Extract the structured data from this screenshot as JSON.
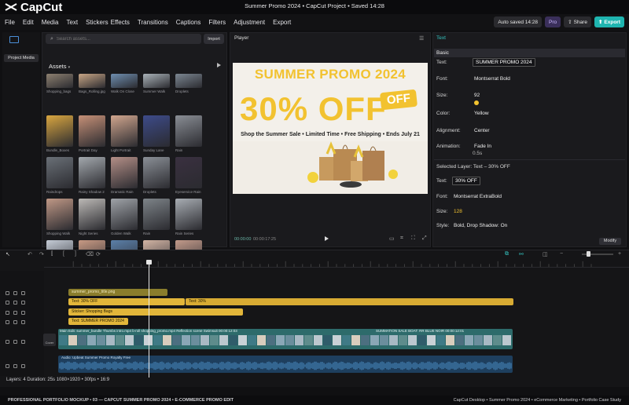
{
  "window": {
    "app_name": "CapCut",
    "title": "Summer Promo 2024 • CapCut Project • Saved 14:28"
  },
  "menu": [
    "File",
    "Edit",
    "Media",
    "Text",
    "Stickers",
    "Effects",
    "Transitions",
    "Captions",
    "Filters",
    "Adjustment",
    "Export"
  ],
  "header_actions": {
    "autosave": "Auto saved 14:28",
    "pro": "Pro",
    "share": "Share",
    "export": "Export"
  },
  "left_rail": {
    "project_media": "Project Media"
  },
  "media": {
    "search_placeholder": "Search assets...",
    "import_label": "Import",
    "assets_label": "Assets",
    "thumbnails": [
      {
        "label": "Shopping_bags",
        "color": "#8d8070"
      },
      {
        "label": "Bags_Rolling.jpg",
        "color": "#c7a585"
      },
      {
        "label": "Walk On Close",
        "color": "#6f8fb0"
      },
      {
        "label": "Summer Walk",
        "color": "#a9b2b8"
      },
      {
        "label": "Droplets",
        "color": "#7c8792"
      },
      {
        "label": "Bundle_Boxes",
        "color": "#d9a640"
      },
      {
        "label": "Portrait Day",
        "color": "#c69077"
      },
      {
        "label": "Light Portrait",
        "color": "#d1a68e"
      },
      {
        "label": "Sunday Lane",
        "color": "#3d4b8a"
      },
      {
        "label": "Rain",
        "color": "#8a8e95"
      },
      {
        "label": "Raindrops",
        "color": "#6a7077"
      },
      {
        "label": "Rainy Shadow 2",
        "color": "#a3a8ad"
      },
      {
        "label": "Dramatic Rain",
        "color": "#b48f87"
      },
      {
        "label": "Droplets",
        "color": "#8b9097"
      },
      {
        "label": "Eyeservice Rain",
        "color": "#3a3040"
      },
      {
        "label": "Shopping Walk",
        "color": "#c09886"
      },
      {
        "label": "Night Series",
        "color": "#bcb9b6"
      },
      {
        "label": "Golden Walk",
        "color": "#9fa3a8"
      },
      {
        "label": "Rain",
        "color": "#7e8489"
      },
      {
        "label": "Rain Series",
        "color": "#a8adb3"
      },
      {
        "label": "",
        "color": "#c5ccd6"
      },
      {
        "label": "",
        "color": "#c89a84"
      },
      {
        "label": "",
        "color": "#5b7fa8"
      },
      {
        "label": "",
        "color": "#d2b4a4"
      },
      {
        "label": "",
        "color": "#c29a8a"
      }
    ]
  },
  "player": {
    "title": "Player",
    "promo_title": "SUMMER PROMO 2024",
    "promo_big": "30% OFF",
    "promo_off_badge": "OFF",
    "promo_sub": "Shop the Summer Sale • Limited Time • Free Shipping • Ends July 21",
    "timecode_current": "00:00:00",
    "timecode_total": "00:00:17:25"
  },
  "inspector": {
    "tab": "Text",
    "section": "Basic",
    "text_label": "Text:",
    "text_value": "SUMMER PROMO 2024",
    "font_label": "Font:",
    "font_value": "Montserrat Bold",
    "size_label": "Size:",
    "size_value": "92",
    "color_label": "Color:",
    "color_value": "Yellow",
    "align_label": "Alignment:",
    "align_value": "Center",
    "anim_label": "Animation:",
    "anim_value": "Fade In",
    "anim_duration": "0.5s",
    "selected_layer": "Selected Layer: Text – 30% OFF",
    "text2_label": "Text:",
    "text2_value": "30% OFF",
    "font2_label": "Font:",
    "font2_value": "Montserrat ExtraBold",
    "size2_label": "Size:",
    "size2_value": "128",
    "style_label": "Style:",
    "style_value": "Bold, Drop Shadow: On",
    "modify": "Modify",
    "accent": "#34c4c0"
  },
  "timeline": {
    "clips": {
      "text1": "summer_promo_title.png",
      "text2": "Text: 30% OFF",
      "text2b": "Text: 30%",
      "sticker": "Sticker: Shopping Bags",
      "text3": "Text: SUMMER PROMO 2024",
      "video": "Main Edit: summer_bundle Thumbs intro.mp4  b-roll shopping_promo.mp4  Reflection scene  Swimsuit  00:00:12:03",
      "video2": "SUMMATION SALE  BOAT: RR  BLUE NOIR  00:00:12:01",
      "audio": "Audio: Upbeat Summer Promo Royalty Free"
    },
    "cover": "Cover",
    "status": "Layers: 4    Duration: 25s    1080×1920  •  30fps  •  16:9"
  },
  "footer": {
    "left": "PROFESSIONAL PORTFOLIO MOCKUP • 03 — CAPCUT SUMMER PROMO 2024 • E-COMMERCE PROMO EDIT",
    "right": "CapCut Desktop • Summer Promo 2024 • eCommerce Marketing • Portfolio Case Study"
  }
}
